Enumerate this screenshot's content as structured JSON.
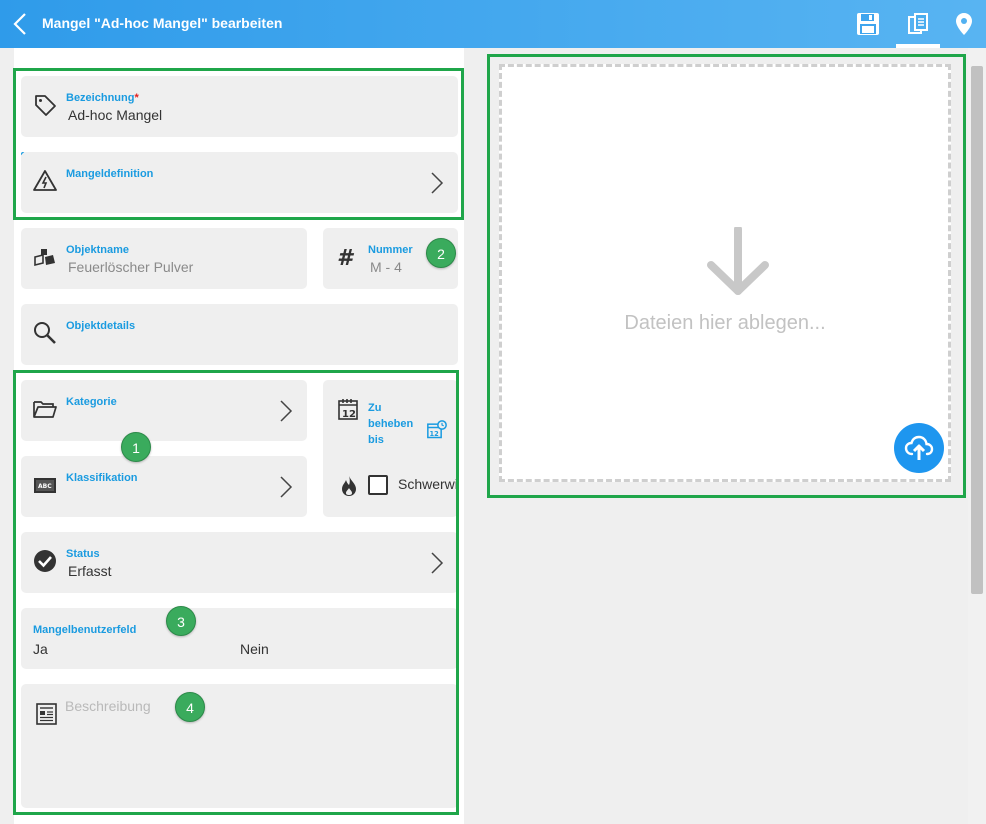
{
  "header": {
    "title": "Mangel \"Ad-hoc Mangel\" bearbeiten",
    "icons": [
      "back-icon",
      "save-icon",
      "documents-icon",
      "location-pin-icon"
    ]
  },
  "form": {
    "bezeichnung": {
      "label": "Bezeichnung",
      "required_mark": "*",
      "value": "Ad-hoc Mangel"
    },
    "mangeldefinition": {
      "label": "Mangeldefinition"
    },
    "objektname": {
      "label": "Objektname",
      "value": "Feuerlöscher Pulver"
    },
    "nummer": {
      "label": "Nummer",
      "value": "M - 4"
    },
    "objektdetails": {
      "label": "Objektdetails"
    },
    "kategorie": {
      "label": "Kategorie"
    },
    "zu_beheben_bis": {
      "label_line1": "Zu",
      "label_line2": "beheben",
      "label_line3": "bis"
    },
    "schwerwiegend": {
      "label": "Schwerwieg",
      "checked": false
    },
    "klassifikation": {
      "label": "Klassifikation"
    },
    "status": {
      "label": "Status",
      "value": "Erfasst"
    },
    "mangelbenutzerfeld": {
      "label": "Mangelbenutzerfeld",
      "value_left": "Ja",
      "value_right": "Nein"
    },
    "beschreibung": {
      "placeholder": "Beschreibung"
    }
  },
  "badges": [
    "1",
    "2",
    "3",
    "4"
  ],
  "dropzone": {
    "text": "Dateien hier ablegen..."
  },
  "colors": {
    "header_start": "#2f9bea",
    "header_end": "#58b4f2",
    "label_blue": "#1a9be0",
    "highlight_green": "#1fa64a",
    "upload_blue": "#1e96ef"
  }
}
